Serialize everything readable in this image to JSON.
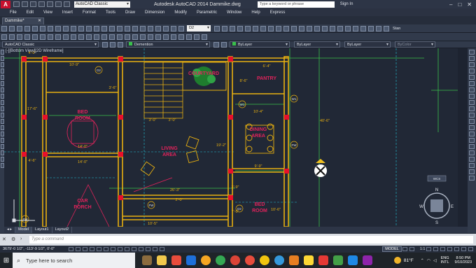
{
  "titlebar": {
    "app_icon": "A",
    "workspace": "AutoCAD Classic",
    "title": "Autodesk AutoCAD 2014   Dammike.dwg",
    "search_placeholder": "Type a keyword or phrase",
    "signin": "Sign In",
    "window_buttons": [
      "–",
      "□",
      "✕"
    ]
  },
  "menubar": [
    "File",
    "Edit",
    "View",
    "Insert",
    "Format",
    "Tools",
    "Draw",
    "Dimension",
    "Modify",
    "Parametric",
    "Window",
    "Help",
    "Express"
  ],
  "tabs": [
    {
      "label": "Dammike*",
      "close": "✕"
    }
  ],
  "toolbar": {
    "workspace_combo": "AutoCAD Classic",
    "layer_combo": "Demention",
    "color_combo": "ByLayer",
    "linetype_combo": "ByLayer",
    "lineweight_combo": "ByLayer",
    "plotstyle_combo": "ByColor",
    "style_combo": "D2",
    "standard_label": "Stan"
  },
  "viewport": {
    "label": "[-][Bottom View][2D Wireframe]",
    "rooms": [
      {
        "name": "BED",
        "name2": "ROOM",
        "color": "#e0235b"
      },
      {
        "name": "COURTYARD",
        "color": "#e0235b"
      },
      {
        "name": "PANTRY",
        "color": "#e0235b"
      },
      {
        "name": "DINING",
        "name2": "AREA",
        "color": "#e0235b"
      },
      {
        "name": "LIVING",
        "name2": "AREA",
        "color": "#e0235b"
      },
      {
        "name": "CAR",
        "name2": "PORCH",
        "color": "#e0235b"
      },
      {
        "name": "BED",
        "name2": "ROOM",
        "color": "#e0235b"
      }
    ],
    "dims": [
      "10'-9\"",
      "6'-4\"",
      "3'-6\"",
      "17'-6\"",
      "14'-0\"",
      "4'-6\"",
      "14'-0\"",
      "3'-0\"",
      "3'-0\"",
      "8'-6\"",
      "10'-4\"",
      "9'-9\"",
      "26'-3\"",
      "10'-5\"",
      "19'-2\"",
      "10'-6\"",
      "7'-0\"",
      "4'-0\"",
      "2'-0\"",
      "3'-9\"",
      "40'-6\""
    ],
    "tags": [
      "D2",
      "W1",
      "FW",
      "W1",
      "FW",
      "D2",
      "FW"
    ],
    "viewcube_label": "WCS",
    "compass": {
      "n": "N",
      "s": "S",
      "e": "E",
      "w": "W"
    }
  },
  "layout_tabs": [
    "Model",
    "Layout1",
    "Layout2"
  ],
  "cmdline": {
    "placeholder": "Type a command"
  },
  "statusbar": {
    "coords": "3679'-0 1/2\", -113'-9 1/2\", 0'-0\"",
    "model": "MODEL",
    "scale": "1:1"
  },
  "taskbar": {
    "search": "Type here to search",
    "weather": "81°F",
    "lang1": "ENG",
    "lang2": "INTL",
    "time": "8:50 PM",
    "date": "9/10/2023",
    "apps": [
      "#8b6b3e",
      "#f2f2f2",
      "#e74c3c",
      "#1e6fd9",
      "#f5a623",
      "#ffffff",
      "#34a853",
      "#e74c3c",
      "#db4437",
      "#3498db",
      "#e67e22",
      "#f1c40f",
      "#fdd835",
      "#e53935",
      "#43a047",
      "#1e88e5",
      "#8e24aa"
    ]
  },
  "colors": {
    "wall": "#e8b010",
    "red": "#e0235b",
    "green": "#39c04a",
    "cyan": "#22c0d6",
    "bg": "#212836"
  }
}
